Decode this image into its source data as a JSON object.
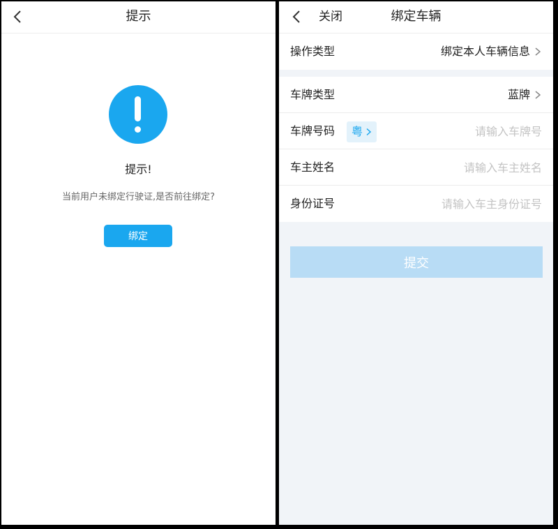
{
  "left": {
    "nav": {
      "title": "提示"
    },
    "alert": {
      "title": "提示!",
      "message": "当前用户未绑定行驶证,是否前往绑定?",
      "button_label": "绑定"
    },
    "colors": {
      "accent": "#1aa7ef"
    }
  },
  "right": {
    "nav": {
      "close_label": "关闭",
      "title": "绑定车辆"
    },
    "operation_type": {
      "label": "操作类型",
      "value": "绑定本人车辆信息"
    },
    "plate_type": {
      "label": "车牌类型",
      "value": "蓝牌"
    },
    "plate_number": {
      "label": "车牌号码",
      "province": "粤",
      "placeholder": "请输入车牌号"
    },
    "owner_name": {
      "label": "车主姓名",
      "placeholder": "请输入车主姓名"
    },
    "id_number": {
      "label": "身份证号",
      "placeholder": "请输入车主身份证号"
    },
    "submit_label": "提交",
    "colors": {
      "background": "#f1f4f8",
      "submit_disabled": "#b8dcf5",
      "placeholder": "#c3c3c3"
    }
  }
}
